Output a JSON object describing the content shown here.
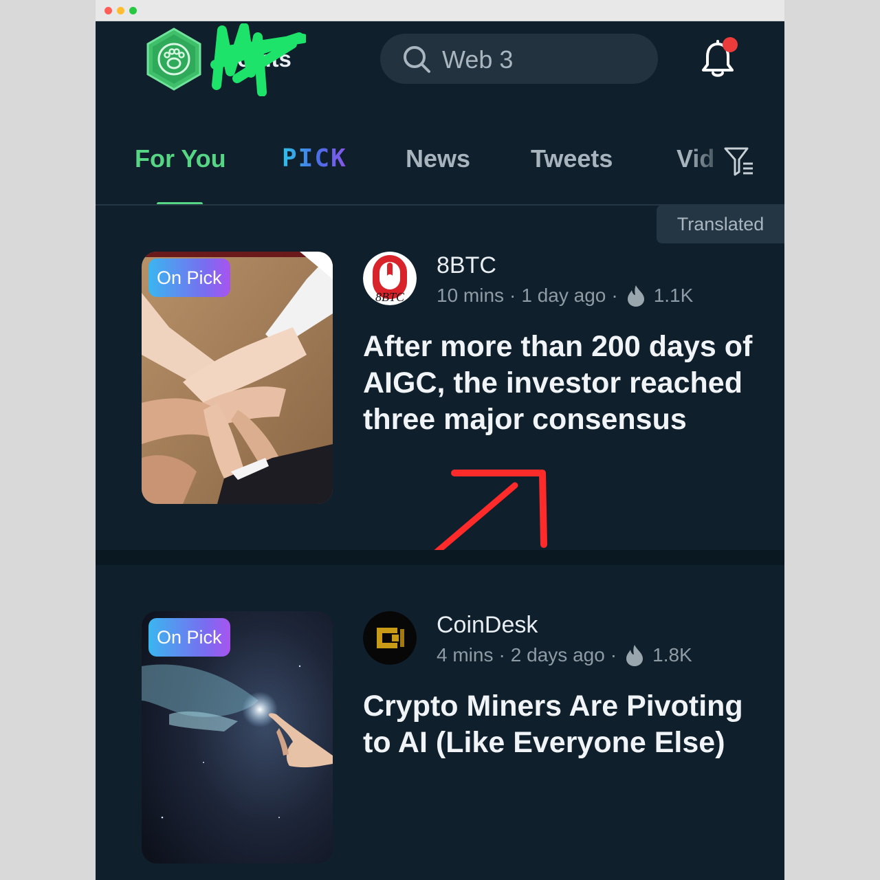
{
  "header": {
    "points_value": "",
    "points_label": "Points",
    "search_placeholder": "Web 3"
  },
  "tabs": [
    {
      "label": "For You"
    },
    {
      "label": "PICK"
    },
    {
      "label": "News"
    },
    {
      "label": "Tweets"
    },
    {
      "label": "Vid"
    }
  ],
  "translated_label": "Translated",
  "articles": [
    {
      "badge": "On Pick",
      "source": "8BTC",
      "read_time": "10 mins",
      "age": "1 day ago",
      "heat": "1.1K",
      "headline": "After more than 200 days of AIGC, the investor reached three major consensus",
      "logo_text": "8BTC"
    },
    {
      "badge": "On Pick",
      "source": "CoinDesk",
      "read_time": "4 mins",
      "age": "2 days ago",
      "heat": "1.8K",
      "headline": "Crypto Miners Are Pivoting to AI (Like Everyone Else)"
    }
  ],
  "colors": {
    "background": "#0f1f2c",
    "accent_green": "#56d684",
    "notification_badge": "#ec3b3b",
    "annotation_arrow": "#ff2a2a"
  },
  "icons": [
    "paw-hexagon-logo",
    "search-icon",
    "bell-icon",
    "filter-list-icon",
    "flame-icon"
  ]
}
